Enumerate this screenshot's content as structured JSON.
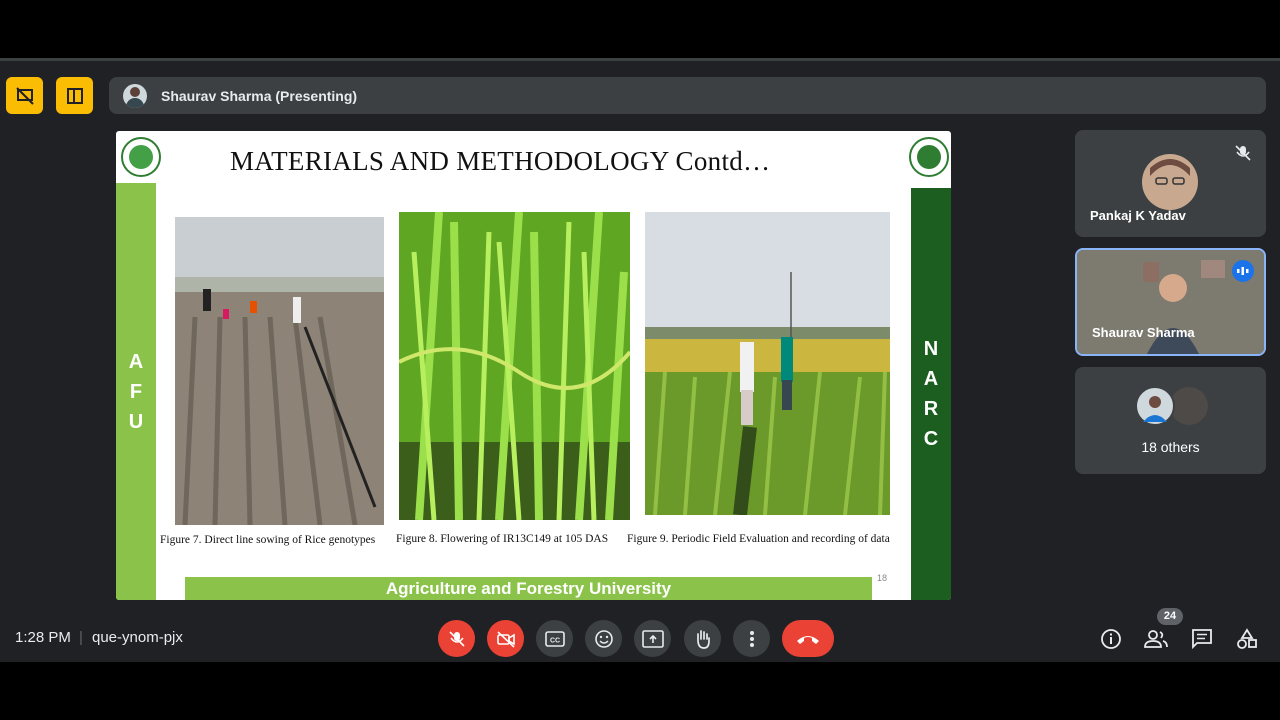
{
  "presenter": {
    "name": "Shaurav Sharma (Presenting)"
  },
  "slide": {
    "title": "MATERIALS AND METHODOLOGY   Contd…",
    "left_side_letters": [
      "A",
      "F",
      "U"
    ],
    "right_side_letters": [
      "N",
      "A",
      "R",
      "C"
    ],
    "captions": [
      "Figure 7. Direct line sowing of Rice genotypes",
      "Figure 8. Flowering of IR13C149 at 105 DAS",
      "Figure 9. Periodic Field Evaluation and recording of data"
    ],
    "footer": "Agriculture and Forestry University",
    "page_number": "18",
    "accent_light_green": "#8bc34a",
    "accent_dark_green": "#1b5e20"
  },
  "participants": [
    {
      "name": "Pankaj K Yadav",
      "muted": true
    },
    {
      "name": "Shaurav Sharma",
      "speaking": true
    },
    {
      "name": "18 others"
    }
  ],
  "bottom_bar": {
    "time": "1:28 PM",
    "meeting_code": "que-ynom-pjx",
    "people_count": "24"
  },
  "controls": [
    "mic-off-icon",
    "camera-off-icon",
    "captions-icon",
    "emoji-icon",
    "present-icon",
    "raise-hand-icon",
    "more-options-icon",
    "end-call-icon"
  ],
  "right_controls": [
    "info-icon",
    "people-icon",
    "chat-icon",
    "activities-icon"
  ]
}
